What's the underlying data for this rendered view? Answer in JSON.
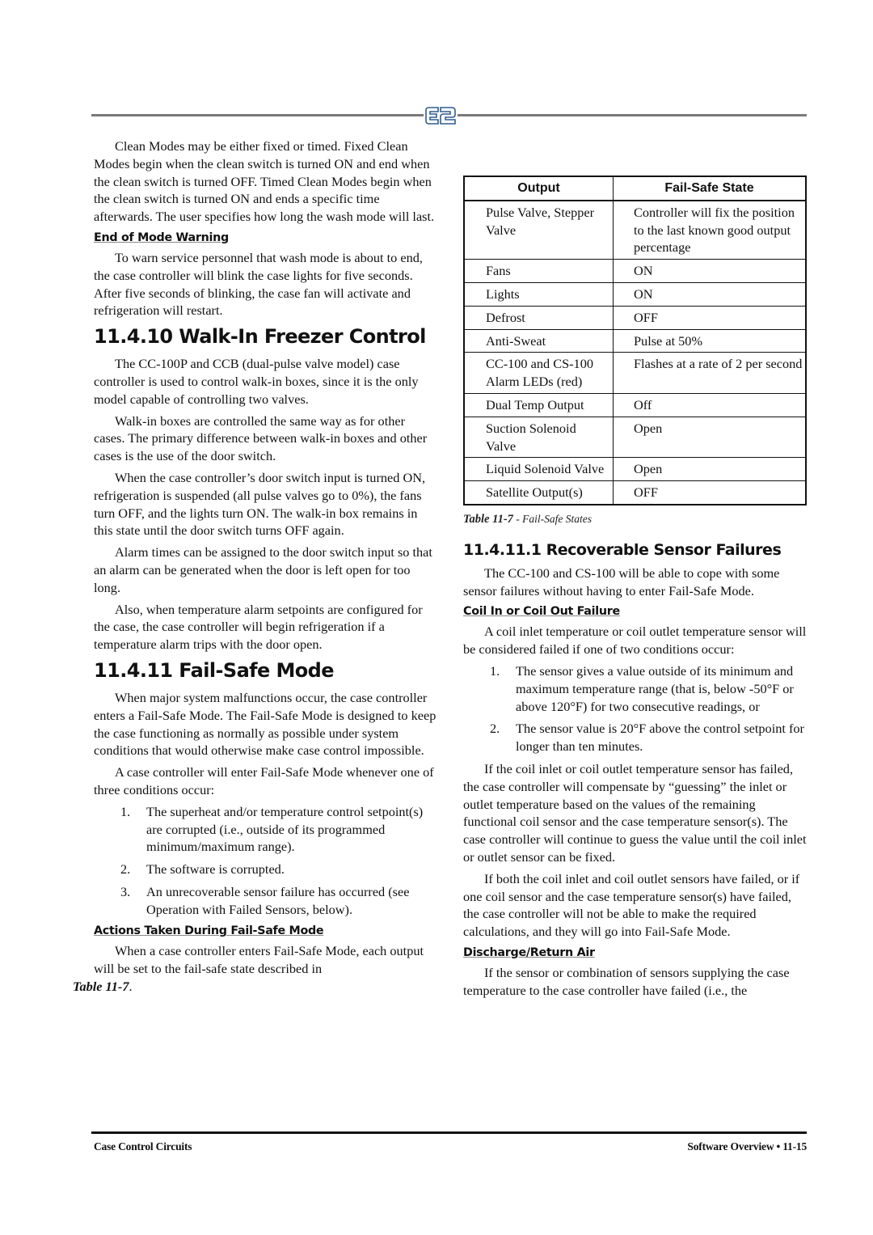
{
  "header": {
    "logo_icon": "e2-logo-icon",
    "logo_text": "E2"
  },
  "left_column": {
    "intro_paragraph": "Clean Modes may be either fixed or timed. Fixed Clean Modes begin when the clean switch is turned ON and end when the clean switch is turned OFF. Timed Clean Modes begin when the clean switch is turned ON and ends a specific time afterwards. The user specifies how long the wash mode will last.",
    "end_of_mode": {
      "heading": "End of Mode Warning",
      "paragraph": "To warn service personnel that wash mode is about to end, the case controller will blink the case lights for five seconds. After five seconds of blinking, the case fan will activate and refrigeration will restart."
    },
    "walkin": {
      "heading": "11.4.10  Walk-In Freezer Control",
      "paragraphs": [
        "The CC-100P and CCB (dual-pulse valve model) case controller is used to control walk-in boxes, since it is the only model capable of controlling two valves.",
        "Walk-in boxes are controlled the same way as for other cases. The primary difference between walk-in boxes and other cases is the use of the door switch.",
        "When the case controller’s door switch input is turned ON, refrigeration is suspended (all pulse valves go to 0%), the fans turn OFF, and the lights turn ON. The walk-in box remains in this state until the door switch turns OFF again.",
        "Alarm times can be assigned to the door switch input so that an alarm can be generated when the door is left open for too long.",
        "Also, when temperature alarm setpoints are configured for the case, the case controller will begin refrigeration if a temperature alarm trips with the door open."
      ]
    },
    "failsafe": {
      "heading": "11.4.11  Fail-Safe Mode",
      "paragraphs": [
        "When major system malfunctions occur, the case controller enters a Fail-Safe Mode. The Fail-Safe Mode is designed to keep the case functioning as normally as possible under system conditions that would otherwise make case control impossible.",
        "A case controller will enter Fail-Safe Mode whenever one of three conditions occur:"
      ],
      "conditions": [
        {
          "num": "1.",
          "text": "The superheat and/or temperature control setpoint(s) are corrupted (i.e., outside of its programmed minimum/maximum range)."
        },
        {
          "num": "2.",
          "text": "The software is corrupted."
        },
        {
          "num": "3.",
          "text": "An unrecoverable sensor failure has occurred (see Operation with Failed Sensors, below)."
        }
      ],
      "actions_heading": "Actions Taken During Fail-Safe Mode",
      "actions_paragraph": "When a case controller enters Fail-Safe Mode, each output will be set to the fail-safe state described in",
      "actions_table_ref": "Table 11-7",
      "actions_end": "."
    }
  },
  "table": {
    "headers": [
      "Output",
      "Fail-Safe State"
    ],
    "rows": [
      {
        "output": "Pulse Valve, Stepper Valve",
        "state": "Controller will fix the position to the last known good output percentage"
      },
      {
        "output": "Fans",
        "state": "ON"
      },
      {
        "output": "Lights",
        "state": "ON"
      },
      {
        "output": "Defrost",
        "state": "OFF"
      },
      {
        "output": "Anti-Sweat",
        "state": "Pulse at 50%"
      },
      {
        "output": "CC-100 and CS-100 Alarm LEDs (red)",
        "state": "Flashes at a rate of 2 per second"
      },
      {
        "output": "Dual Temp Output",
        "state": "Off"
      },
      {
        "output": "Suction Solenoid Valve",
        "state": "Open"
      },
      {
        "output": "Liquid Solenoid Valve",
        "state": "Open"
      },
      {
        "output": "Satellite Output(s)",
        "state": "OFF"
      }
    ],
    "caption_label": "Table 11-7",
    "caption_text": " - Fail-Safe States"
  },
  "right_column": {
    "recoverable": {
      "heading": "11.4.11.1  Recoverable Sensor Failures",
      "paragraph": "The CC-100 and CS-100 will be able to cope with some sensor failures without having to enter Fail-Safe Mode."
    },
    "coil": {
      "heading": "Coil In or Coil Out Failure",
      "paragraph": "A coil inlet temperature or coil outlet temperature sensor will be considered failed if one of two conditions occur:",
      "conditions": [
        {
          "num": "1.",
          "text": "The sensor gives a value outside of its minimum and maximum temperature range (that is, below -50°F or above 120°F) for two consecutive readings, or"
        },
        {
          "num": "2.",
          "text": "The sensor value is 20°F above the control setpoint for longer than ten minutes."
        }
      ],
      "paragraphs": [
        "If the coil inlet or coil outlet temperature sensor has failed, the case controller will compensate by “guessing” the inlet or outlet temperature based on the values of the remaining functional coil sensor and the case temperature sensor(s). The case controller will continue to guess the value until the coil inlet or outlet sensor can be fixed.",
        "If both the coil inlet and coil outlet sensors have failed, or if one coil sensor and the case temperature sensor(s) have failed, the case controller will not be able to make the required calculations, and they will go into Fail-Safe Mode."
      ]
    },
    "discharge": {
      "heading": "Discharge/Return Air",
      "paragraph": "If the sensor or combination of sensors supplying the case temperature to the case controller have failed (i.e., the"
    }
  },
  "footer": {
    "left": "Case Control Circuits",
    "right": "Software Overview • 11-15"
  }
}
